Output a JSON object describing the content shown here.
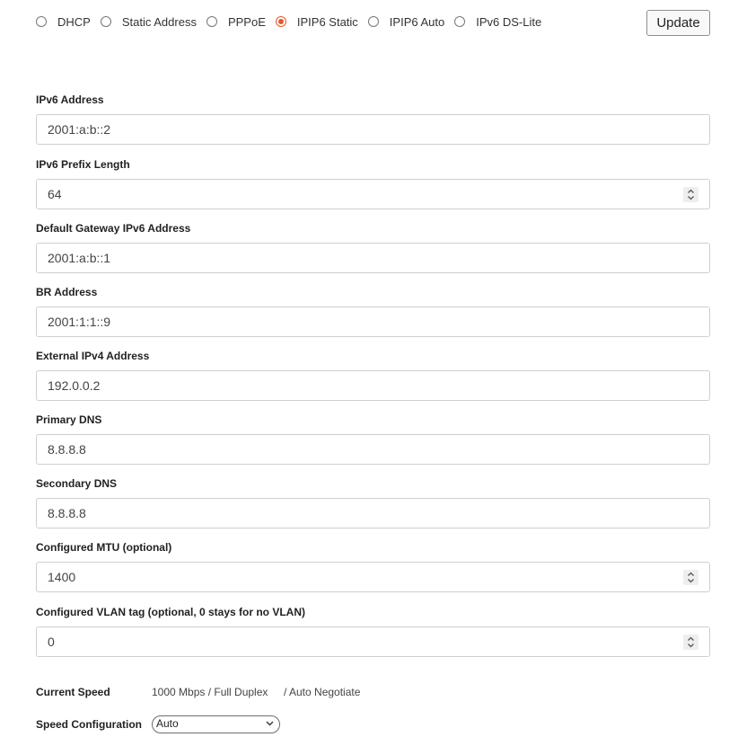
{
  "connection_types": [
    {
      "label": "DHCP",
      "checked": false
    },
    {
      "label": "Static Address",
      "checked": false
    },
    {
      "label": "PPPoE",
      "checked": false
    },
    {
      "label": "IPIP6 Static",
      "checked": true
    },
    {
      "label": "IPIP6 Auto",
      "checked": false
    },
    {
      "label": "IPv6 DS-Lite",
      "checked": false
    }
  ],
  "update_label": "Update",
  "accent_color": "#e8572c",
  "fields": {
    "ipv6_address": {
      "label": "IPv6 Address",
      "value": "2001:a:b::2"
    },
    "ipv6_prefix_length": {
      "label": "IPv6 Prefix Length",
      "value": "64"
    },
    "default_gateway": {
      "label": "Default Gateway IPv6 Address",
      "value": "2001:a:b::1"
    },
    "br_address": {
      "label": "BR Address",
      "value": "2001:1:1::9"
    },
    "external_ipv4": {
      "label": "External IPv4 Address",
      "value": "192.0.0.2"
    },
    "primary_dns": {
      "label": "Primary DNS",
      "value": "8.8.8.8"
    },
    "secondary_dns": {
      "label": "Secondary DNS",
      "value": "8.8.8.8"
    },
    "mtu": {
      "label": "Configured MTU (optional)",
      "value": "1400"
    },
    "vlan_tag": {
      "label": "Configured VLAN tag (optional, 0 stays for no VLAN)",
      "value": "0"
    }
  },
  "current_speed": {
    "label": "Current Speed",
    "value": "1000 Mbps / Full Duplex",
    "negotiation": "/ Auto Negotiate"
  },
  "speed_configuration": {
    "label": "Speed Configuration",
    "selected": "Auto"
  }
}
